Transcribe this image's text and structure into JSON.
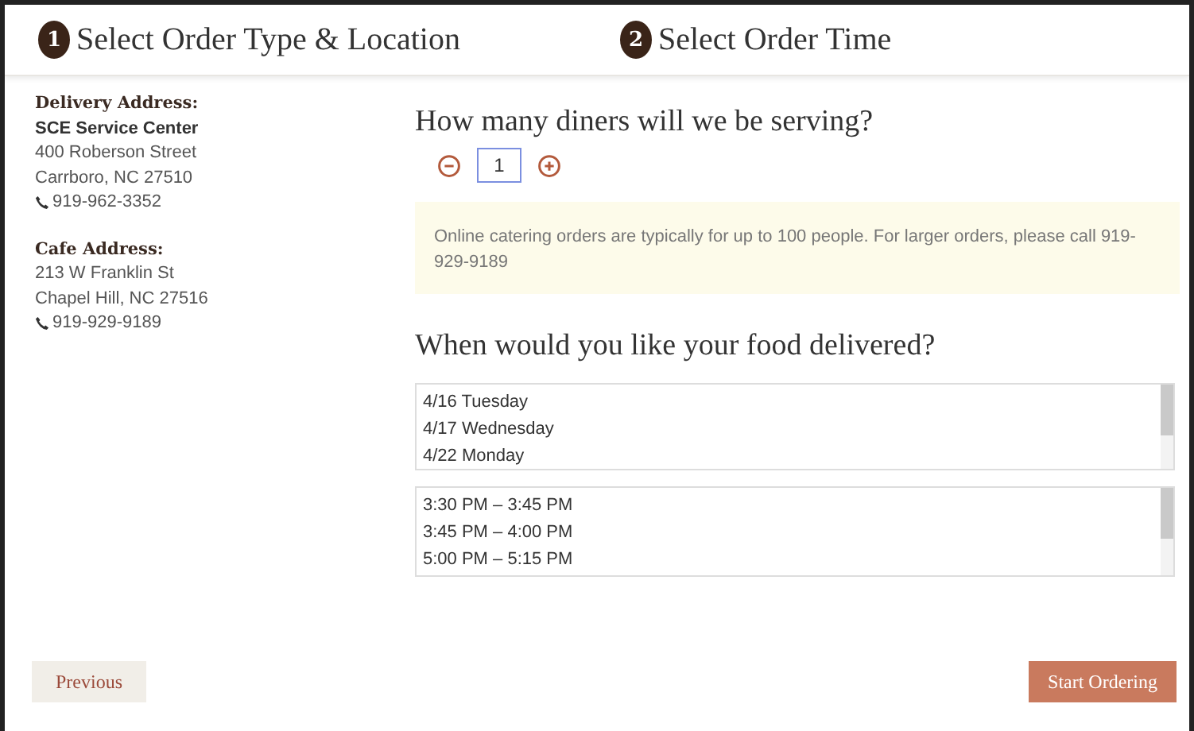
{
  "steps": [
    {
      "number": "1",
      "label": "Select Order Type & Location"
    },
    {
      "number": "2",
      "label": "Select Order Time"
    }
  ],
  "addresses": [
    {
      "heading": "Delivery Address:",
      "name": "SCE Service Center",
      "lines": [
        "400 Roberson Street",
        "Carrboro, NC 27510"
      ],
      "phone": "919-962-3352"
    },
    {
      "heading": "Cafe Address:",
      "lines": [
        "213 W Franklin St",
        "Chapel Hill, NC 27516"
      ],
      "phone": "919-929-9189"
    }
  ],
  "diners": {
    "question": "How many diners will we be serving?",
    "value": "1",
    "notice": "Online catering orders are typically for up to 100 people. For larger orders, please call 919-929-9189"
  },
  "delivery": {
    "question": "When would you like your food delivered?",
    "dates": [
      "4/16 Tuesday",
      "4/17 Wednesday",
      "4/22 Monday"
    ],
    "times": [
      "3:30 PM – 3:45 PM",
      "3:45 PM – 4:00 PM",
      "5:00 PM – 5:15 PM"
    ]
  },
  "buttons": {
    "previous": "Previous",
    "next": "Start Ordering"
  }
}
